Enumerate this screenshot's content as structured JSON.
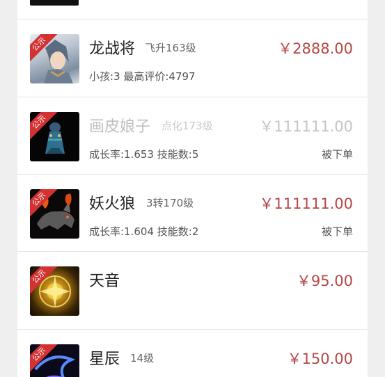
{
  "list": {
    "items": [
      {
        "badge": "公示",
        "name": "龙战将",
        "level": "飞升163级",
        "price": "￥2888.00",
        "detail": "小孩:3 最高评价:4797",
        "status": ""
      },
      {
        "badge": "公示",
        "name": "画皮娘子",
        "level": "点化173级",
        "price": "￥111111.00",
        "detail": "成长率:1.653 技能数:5",
        "status": "被下单"
      },
      {
        "badge": "公示",
        "name": "妖火狼",
        "level": "3转170级",
        "price": "￥111111.00",
        "detail": "成长率:1.604 技能数:2",
        "status": "被下单"
      },
      {
        "badge": "公示",
        "name": "天音",
        "level": "",
        "price": "￥95.00",
        "detail": "",
        "status": ""
      },
      {
        "badge": "公示",
        "name": "星辰",
        "level": "14级",
        "price": "￥150.00",
        "detail": "",
        "status": ""
      }
    ]
  },
  "colors": {
    "price": "#b84646",
    "badge": "#d33232",
    "background": "#efefef"
  }
}
